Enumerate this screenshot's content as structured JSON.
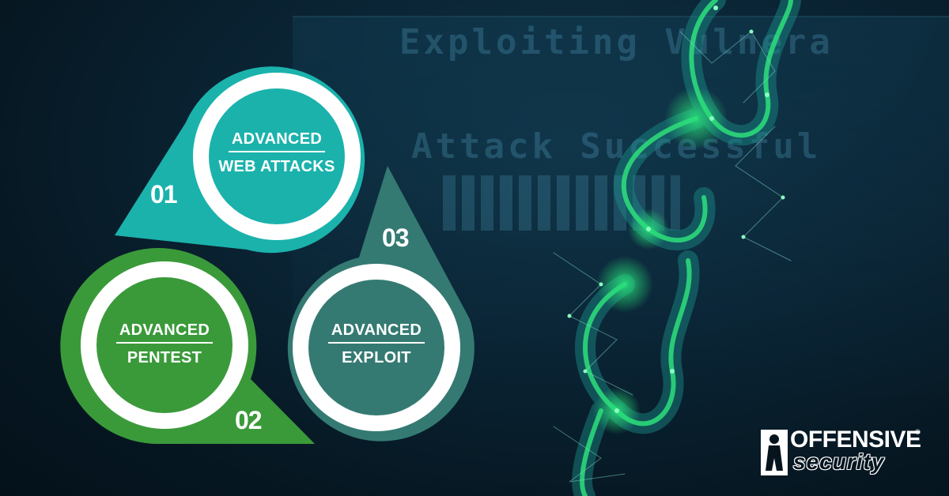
{
  "background": {
    "line1": "Exploiting Vulnera",
    "line2": "Attack Successful"
  },
  "steps": [
    {
      "number": "01",
      "line1": "ADVANCED",
      "line2": "WEB ATTACKS",
      "color": "#1bb2ac"
    },
    {
      "number": "02",
      "line1": "ADVANCED",
      "line2": "PENTEST",
      "color": "#3a9a3a"
    },
    {
      "number": "03",
      "line1": "ADVANCED",
      "line2": "EXPLOIT",
      "color": "#347a72"
    }
  ],
  "logo": {
    "word1": "OFFENSIVE",
    "word2": "security",
    "registered": "®",
    "icon": "person-silhouette-icon"
  },
  "decoration": {
    "image": "broken-chain-network-icon",
    "glow_color": "#29e07a"
  }
}
